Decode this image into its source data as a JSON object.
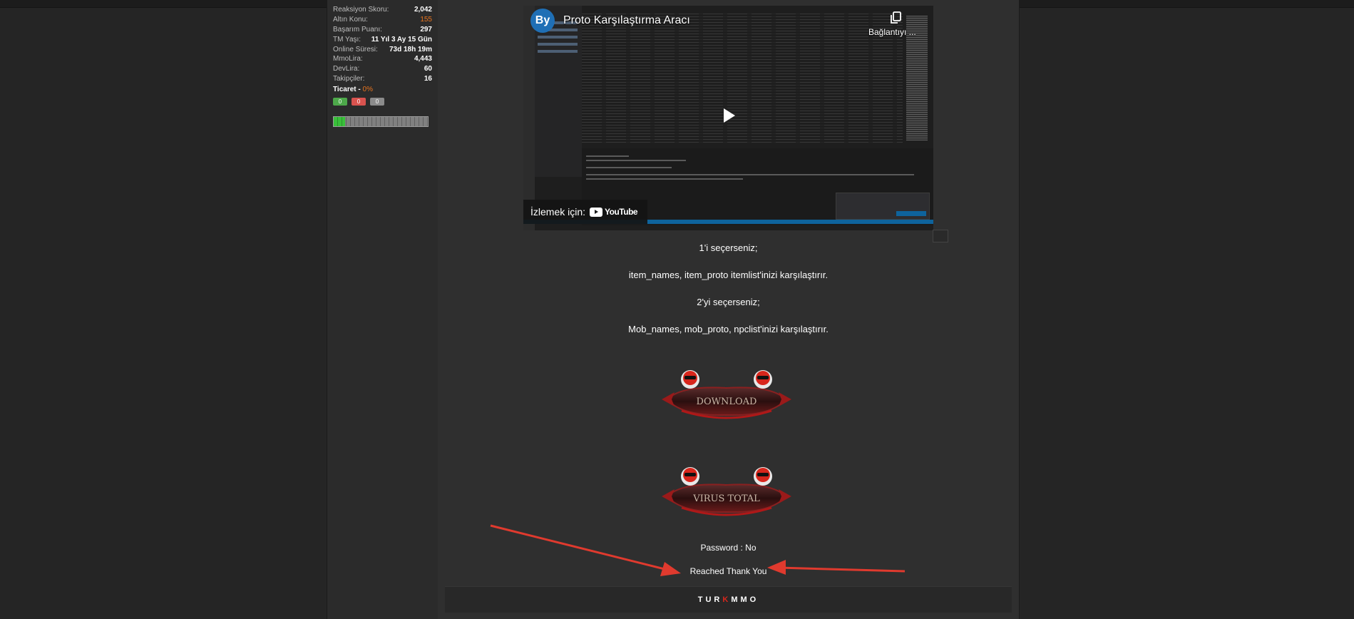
{
  "colors": {
    "accent_orange": "#e8741e",
    "red_arrow": "#e03a2e",
    "avatar_blue": "#1f6fb5",
    "progress_green": "#39c03a"
  },
  "sidebar": {
    "stats": [
      {
        "label": "Reaksiyon Skoru:",
        "value": "2,042"
      },
      {
        "label": "Altın Konu:",
        "value": "155"
      },
      {
        "label": "Başarım Puanı:",
        "value": "297"
      },
      {
        "label": "TM Yaşı:",
        "value": "11 Yıl 3 Ay 15 Gün"
      },
      {
        "label": "Online Süresi:",
        "value": "73d 18h 19m"
      },
      {
        "label": "MmoLira:",
        "value": "4,443"
      },
      {
        "label": "DevLira:",
        "value": "60"
      },
      {
        "label": "Takipçiler:",
        "value": "16"
      }
    ],
    "trade_label": "Ticaret -",
    "trade_percent": "0%",
    "trade_badges": [
      {
        "value": "0",
        "color": "green"
      },
      {
        "value": "0",
        "color": "red"
      },
      {
        "value": "0",
        "color": "gray"
      }
    ],
    "progress_fraction": 0.12
  },
  "video": {
    "avatar_text": "By",
    "title": "Proto Karşılaştırma Aracı",
    "copy_label": "Bağlantıyı ...",
    "watch_label": "İzlemek için:",
    "youtube_text": "YouTube",
    "icons": [
      "copy-link-icon",
      "play-icon",
      "youtube-logo-icon"
    ]
  },
  "post": {
    "lines": [
      "1'i seçerseniz;",
      "item_names, item_proto itemlist'inizi karşılaştırır.",
      "2'yi seçerseniz;",
      "Mob_names, mob_proto, npclist'inizi karşılaştırır."
    ],
    "download_label": "DOWNLOAD",
    "virustotal_label": "VIRUS TOTAL",
    "password_line": "Password : No",
    "reached_line": "Reached Thank You"
  },
  "footer": {
    "logo_left": "TUR",
    "logo_k": "K",
    "logo_right": "MMO"
  }
}
